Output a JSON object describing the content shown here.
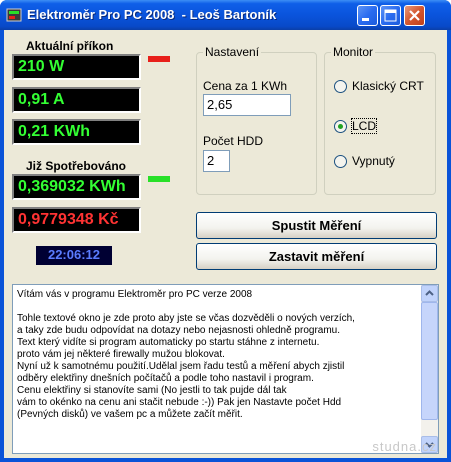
{
  "window": {
    "title": "Elektroměr Pro PC 2008  - Leoš Bartoník"
  },
  "left_panel": {
    "current_power_label": "Aktuální příkon",
    "power_value": "210 W",
    "current_value": "0,91 A",
    "kwh_value": "0,21 KWh",
    "consumed_label": "Již Spotřebováno",
    "consumed_kwh": "0,369032 KWh",
    "consumed_cost": "0,9779348 Kč",
    "clock": "22:06:12",
    "indicator_top_color": "#e8201a",
    "indicator_bottom_color": "#28e028"
  },
  "settings": {
    "group_title": "Nastavení",
    "price_label": "Cena za 1 KWh",
    "price_value": "2,65",
    "hdd_label": "Počet HDD",
    "hdd_value": "2"
  },
  "monitor": {
    "group_title": "Monitor",
    "options": [
      {
        "label": "Klasický CRT",
        "selected": false
      },
      {
        "label": "LCD",
        "selected": true
      },
      {
        "label": "Vypnutý",
        "selected": false
      }
    ]
  },
  "buttons": {
    "start": "Spustit Měření",
    "stop": "Zastavit měření"
  },
  "info_text": "Vítám vás v programu Elektroměr pro PC verze 2008\n\nTohle textové okno je zde proto aby jste se včas dozvěděli o nových verzích,\na taky zde budu odpovídat na dotazy nebo nejasnosti ohledně programu.\nText který vidíte si program automaticky po startu stáhne z internetu.\nproto vám jej některé firewally mužou blokovat.\nNyní už k samotnému použití.Udělal jsem řadu testů a měření abych zjistil\nodběry elektřiny dnešních počítačů a podle toho nastavil i program.\nCenu elektřiny si stanovíte sami (No jestli to tak pujde dál tak\nvám to okénko na cenu ani stačit nebude :-)) Pak jen Nastavte počet Hdd\n(Pevných disků) ve vašem pc a můžete začít měřit.",
  "watermark": "studna.cz"
}
